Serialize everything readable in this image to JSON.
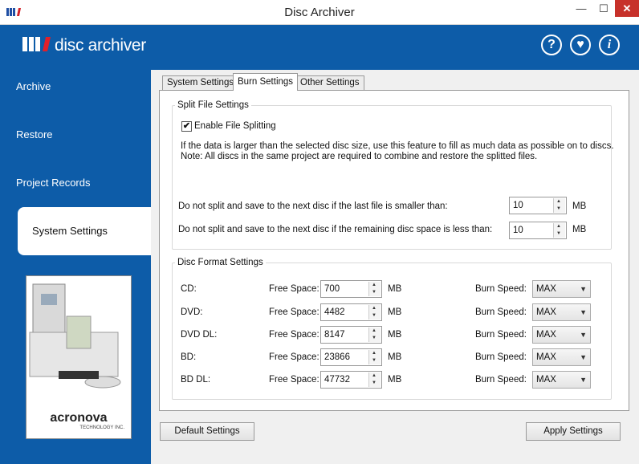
{
  "window": {
    "title": "Disc Archiver",
    "min": "—",
    "max": "☐",
    "close": "✕"
  },
  "header": {
    "logo_text": "disc archiver",
    "help": "?",
    "heart": "♥",
    "info": "i"
  },
  "sidebar": {
    "items": [
      {
        "label": "Archive"
      },
      {
        "label": "Restore"
      },
      {
        "label": "Project Records"
      },
      {
        "label": "System Settings"
      }
    ]
  },
  "promo": {
    "brand": "acronova",
    "tagline": "TECHNOLOGY INC."
  },
  "tabs": [
    {
      "label": "System Settings"
    },
    {
      "label": "Burn Settings"
    },
    {
      "label": "Other Settings"
    }
  ],
  "split": {
    "title": "Split File Settings",
    "enable_label": "Enable File Splitting",
    "enabled": true,
    "desc1": "If the data is larger than the selected disc size, use this feature to fill as much data as possible on to discs.",
    "desc2": "Note: All discs in the same project are required to combine and restore the splitted files.",
    "rule1": "Do not split and save to the next disc if the last file is smaller than:",
    "rule1_value": "10",
    "rule2": "Do not split and save to the next disc if the remaining disc space is less than:",
    "rule2_value": "10",
    "unit": "MB"
  },
  "format": {
    "title": "Disc Format Settings",
    "free_label": "Free Space:",
    "unit": "MB",
    "speed_label": "Burn Speed:",
    "rows": [
      {
        "name": "CD:",
        "free": "700",
        "speed": "MAX"
      },
      {
        "name": "DVD:",
        "free": "4482",
        "speed": "MAX"
      },
      {
        "name": "DVD DL:",
        "free": "8147",
        "speed": "MAX"
      },
      {
        "name": "BD:",
        "free": "23866",
        "speed": "MAX"
      },
      {
        "name": "BD DL:",
        "free": "47732",
        "speed": "MAX"
      }
    ]
  },
  "buttons": {
    "default": "Default Settings",
    "apply": "Apply Settings"
  },
  "colors": {
    "brand_blue": "#0d5ca8",
    "close_red": "#c7312a"
  }
}
